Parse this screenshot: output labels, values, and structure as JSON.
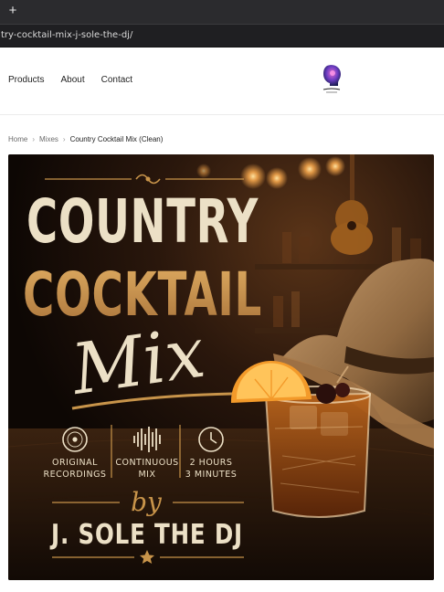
{
  "browser": {
    "new_tab_glyph": "+",
    "url_visible": "try-cocktail-mix-j-sole-the-dj/"
  },
  "header": {
    "nav": [
      {
        "label": "Products"
      },
      {
        "label": "About"
      },
      {
        "label": "Contact"
      }
    ],
    "logo_text": "Sole Mix"
  },
  "breadcrumb": {
    "home": "Home",
    "section": "Mixes",
    "current": "Country Cocktail Mix (Clean)",
    "separator": "›"
  },
  "cover": {
    "title_line1": "COUNTRY",
    "title_line2": "COCKTAIL",
    "title_script": "Mix",
    "feature1_line1": "ORIGINAL",
    "feature1_line2": "RECORDINGS",
    "feature2_line1": "CONTINUOUS",
    "feature2_line2": "MIX",
    "feature3_line1": "2 HOURS",
    "feature3_line2": "3 MINUTES",
    "by": "by",
    "artist": "J. SOLE THE DJ",
    "colors": {
      "cream": "#ece0c6",
      "gold": "#c8944a",
      "background": "#1a100a"
    }
  }
}
